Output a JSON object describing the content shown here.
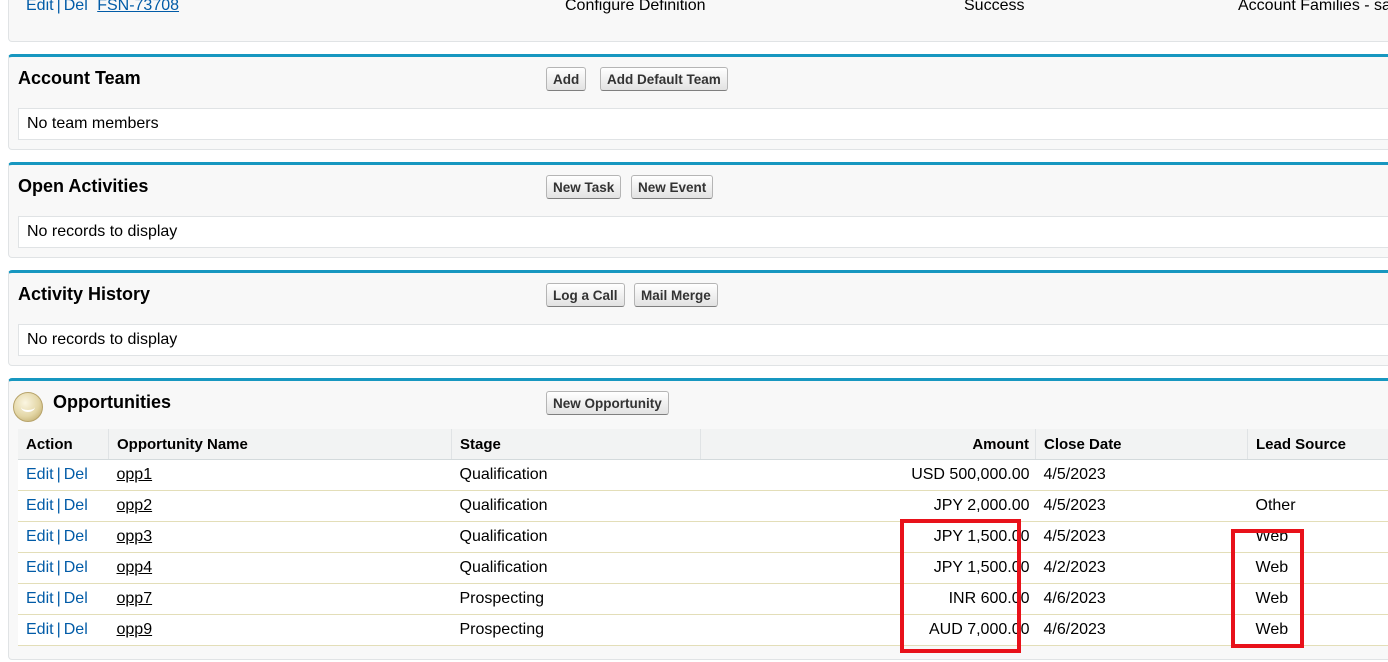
{
  "top_row": {
    "edit": "Edit",
    "del": "Del",
    "separator": "|",
    "record": "FSN-73708",
    "action": "Configure Definition",
    "status": "Success",
    "name": "Account Families - sa"
  },
  "account_team": {
    "title": "Account Team",
    "buttons": [
      "Add",
      "Add Default Team"
    ],
    "empty": "No team members"
  },
  "open_activities": {
    "title": "Open Activities",
    "buttons": [
      "New Task",
      "New Event"
    ],
    "empty": "No records to display"
  },
  "activity_history": {
    "title": "Activity History",
    "buttons": [
      "Log a Call",
      "Mail Merge"
    ],
    "empty": "No records to display"
  },
  "opportunities": {
    "title": "Opportunities",
    "icon": "opportunities-icon",
    "button": "New Opportunity",
    "columns": [
      "Action",
      "Opportunity Name",
      "Stage",
      "Amount",
      "Close Date",
      "Lead Source"
    ],
    "rows": [
      {
        "edit": "Edit",
        "sep": "|",
        "del": "Del",
        "name": "opp1",
        "stage": "Qualification",
        "amount": "USD 500,000.00",
        "close_date": "4/5/2023",
        "lead_source": ""
      },
      {
        "edit": "Edit",
        "sep": "|",
        "del": "Del",
        "name": "opp2",
        "stage": "Qualification",
        "amount": "JPY 2,000.00",
        "close_date": "4/5/2023",
        "lead_source": "Other"
      },
      {
        "edit": "Edit",
        "sep": "|",
        "del": "Del",
        "name": "opp3",
        "stage": "Qualification",
        "amount": "JPY 1,500.00",
        "close_date": "4/5/2023",
        "lead_source": "Web"
      },
      {
        "edit": "Edit",
        "sep": "|",
        "del": "Del",
        "name": "opp4",
        "stage": "Qualification",
        "amount": "JPY 1,500.00",
        "close_date": "4/2/2023",
        "lead_source": "Web"
      },
      {
        "edit": "Edit",
        "sep": "|",
        "del": "Del",
        "name": "opp7",
        "stage": "Prospecting",
        "amount": "INR 600.00",
        "close_date": "4/6/2023",
        "lead_source": "Web"
      },
      {
        "edit": "Edit",
        "sep": "|",
        "del": "Del",
        "name": "opp9",
        "stage": "Prospecting",
        "amount": "AUD 7,000.00",
        "close_date": "4/6/2023",
        "lead_source": "Web"
      }
    ]
  },
  "highlight_color": "#e8111a",
  "accent_color": "#1797c0",
  "link_color": "#015ba7"
}
